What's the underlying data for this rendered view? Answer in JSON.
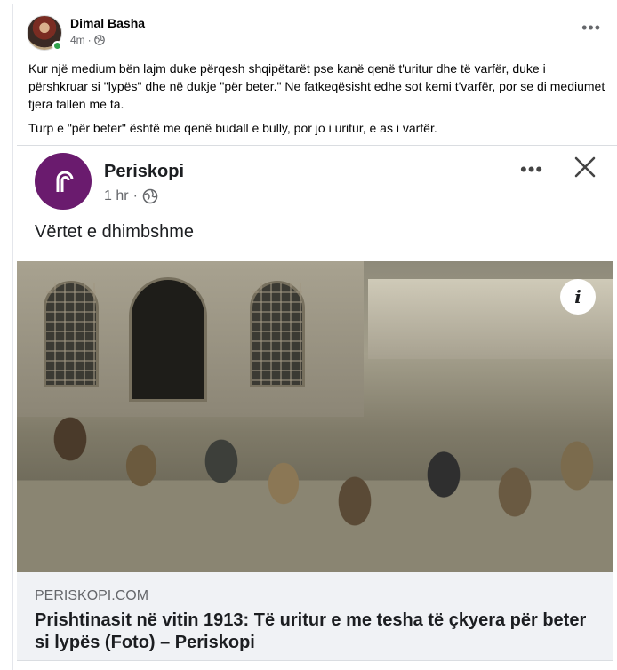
{
  "post": {
    "author": "Dimal Basha",
    "time": "4m",
    "separator": "·",
    "more": "•••",
    "paragraph1": "Kur një medium bën lajm duke përqesh shqipëtarët pse kanë qenë t'uritur dhe të varfër, duke i përshkruar si \"lypës\" dhe në dukje \"për beter.\" Ne fatkeqësisht edhe sot kemi t'varfër, por se di mediumet tjera tallen me ta.",
    "paragraph2": "Turp e \"për beter\" është me qenë budall e bully, por jo i uritur, e as i varfër."
  },
  "shared": {
    "page_name": "Periskopi",
    "time": "1 hr",
    "separator": "·",
    "more": "•••",
    "text": "Vërtet e dhimbshme",
    "info_glyph": "i",
    "link": {
      "domain": "PERISKOPI.COM",
      "title": "Prishtinasit në vitin 1913: Të uritur e me tesha të çkyera për beter si lypës (Foto) – Periskopi"
    }
  },
  "colors": {
    "accent": "#6a1b6e",
    "online": "#31a24c",
    "muted": "#65676b",
    "link_bg": "#f0f2f5"
  },
  "icons": [
    "globe-icon",
    "more-icon",
    "close-icon",
    "info-icon",
    "periskopi-logo"
  ]
}
